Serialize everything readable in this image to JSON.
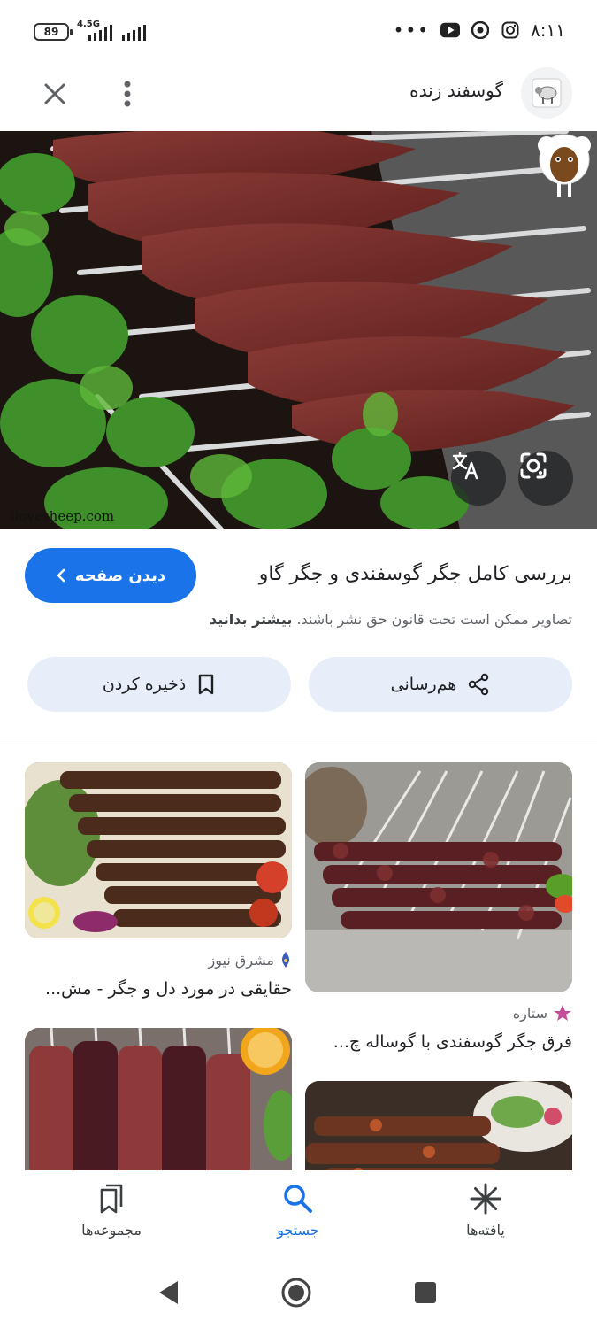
{
  "status_bar": {
    "battery": "89",
    "network": "4.5G",
    "more": "•••",
    "time": "۸:۱۱"
  },
  "header": {
    "site_name": "گوسفند زنده"
  },
  "hero": {
    "watermark": "ilovesheep.com"
  },
  "result": {
    "title": "بررسی کامل جگر گوسفندی و جگر گاو",
    "visit_label": "دیدن صفحه",
    "copyright_text": "تصاویر ممکن است تحت قانون حق نشر باشند.",
    "learn_more": "بیشتر بدانید"
  },
  "actions": {
    "share_label": "هم‌رسانی",
    "save_label": "ذخیره کردن"
  },
  "related": [
    {
      "source": "مشرق نیوز",
      "title": "حقایقی در مورد دل و جگر - مش..."
    },
    {
      "source": "ستاره",
      "title": "فرق جگر گوسفندی با گوساله چ..."
    }
  ],
  "bottom_nav": {
    "items": [
      {
        "label": "مجموعه‌ها",
        "icon": "bookmarks-icon"
      },
      {
        "label": "جستجو",
        "icon": "search-icon"
      },
      {
        "label": "یافته‌ها",
        "icon": "asterisk-icon"
      }
    ],
    "active": "جستجو"
  },
  "colors": {
    "accent": "#1a73e8",
    "action_bg": "#e8eef9"
  }
}
